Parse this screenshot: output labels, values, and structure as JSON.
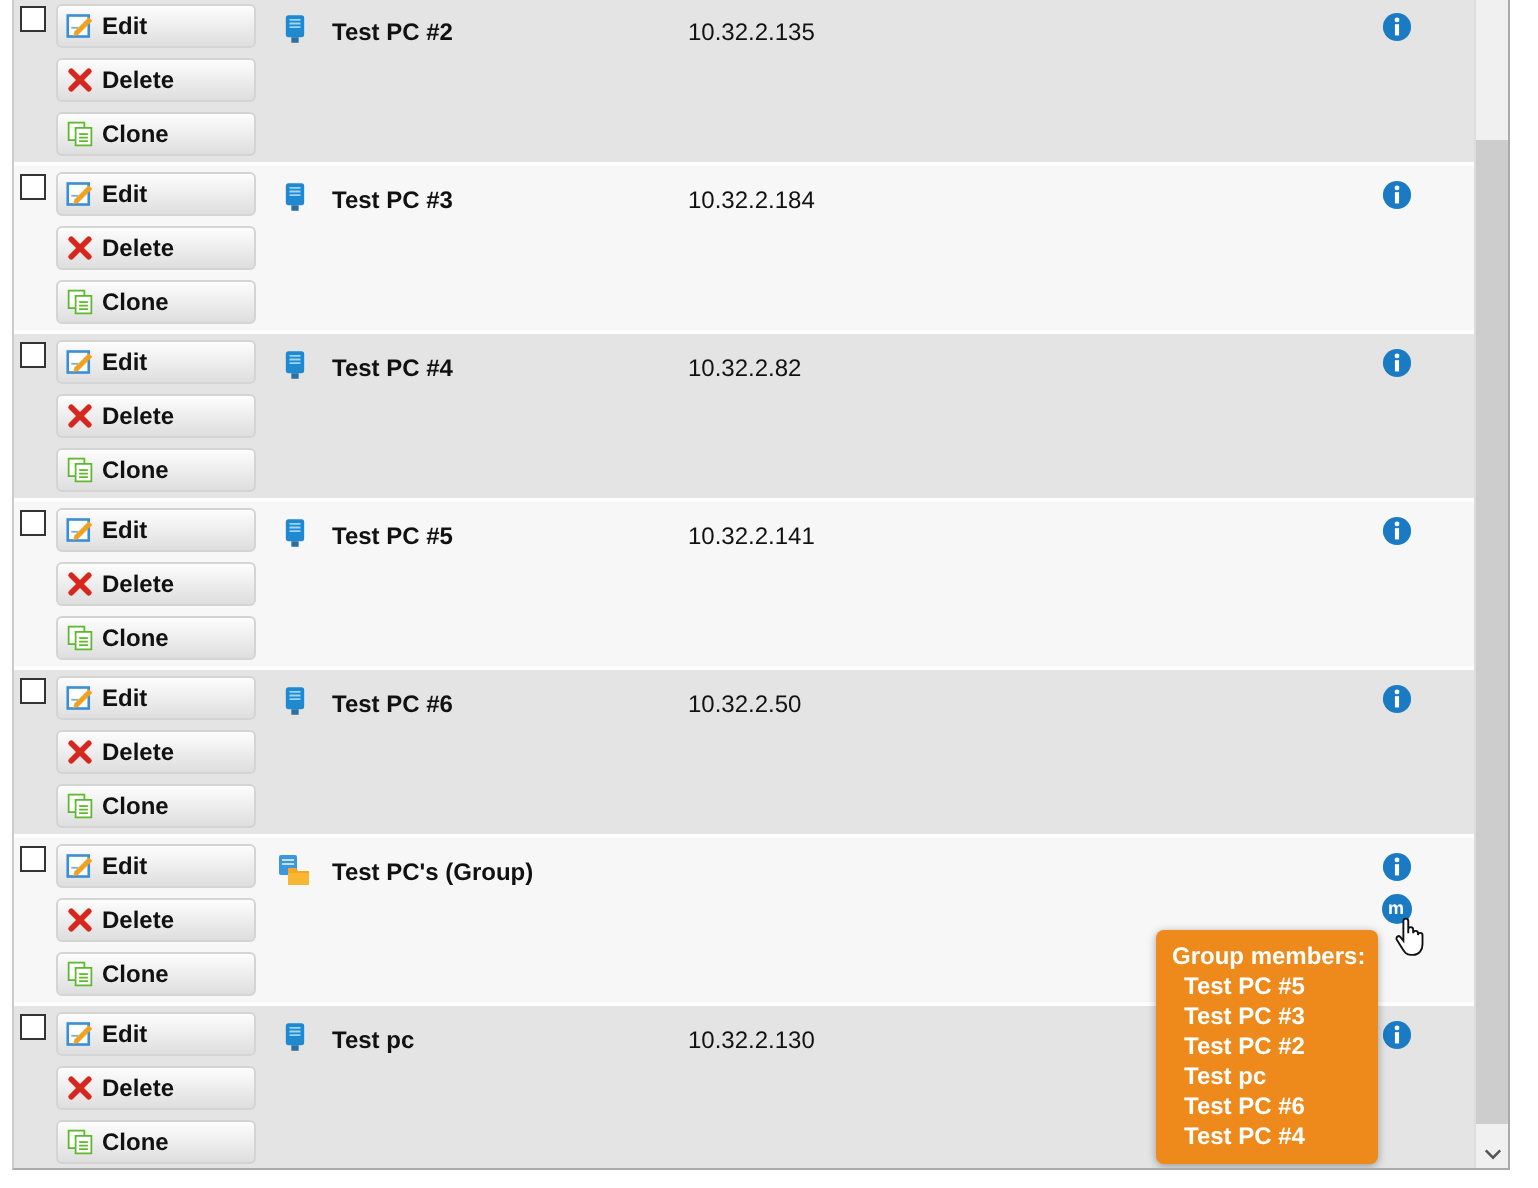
{
  "rows": [
    {
      "kind": "pc",
      "checked": false,
      "name": "Test PC #2",
      "ip": "10.32.2.135",
      "actions": [
        {
          "kind": "edit",
          "label": "Edit"
        },
        {
          "kind": "delete",
          "label": "Delete"
        },
        {
          "kind": "clone",
          "label": "Clone"
        }
      ]
    },
    {
      "kind": "pc",
      "checked": false,
      "name": "Test PC #3",
      "ip": "10.32.2.184",
      "actions": [
        {
          "kind": "edit",
          "label": "Edit"
        },
        {
          "kind": "delete",
          "label": "Delete"
        },
        {
          "kind": "clone",
          "label": "Clone"
        }
      ]
    },
    {
      "kind": "pc",
      "checked": false,
      "name": "Test PC #4",
      "ip": "10.32.2.82",
      "actions": [
        {
          "kind": "edit",
          "label": "Edit"
        },
        {
          "kind": "delete",
          "label": "Delete"
        },
        {
          "kind": "clone",
          "label": "Clone"
        }
      ]
    },
    {
      "kind": "pc",
      "checked": false,
      "name": "Test PC #5",
      "ip": "10.32.2.141",
      "actions": [
        {
          "kind": "edit",
          "label": "Edit"
        },
        {
          "kind": "delete",
          "label": "Delete"
        },
        {
          "kind": "clone",
          "label": "Clone"
        }
      ]
    },
    {
      "kind": "pc",
      "checked": false,
      "name": "Test PC #6",
      "ip": "10.32.2.50",
      "actions": [
        {
          "kind": "edit",
          "label": "Edit"
        },
        {
          "kind": "delete",
          "label": "Delete"
        },
        {
          "kind": "clone",
          "label": "Clone"
        }
      ]
    },
    {
      "kind": "group",
      "checked": false,
      "name": "Test PC's (Group)",
      "members_button": "m",
      "tooltip": {
        "title": "Group members:",
        "members": [
          "Test PC #5",
          "Test PC #3",
          "Test PC #2",
          "Test pc",
          "Test PC #6",
          "Test PC #4"
        ]
      },
      "actions": [
        {
          "kind": "edit",
          "label": "Edit"
        },
        {
          "kind": "delete",
          "label": "Delete"
        },
        {
          "kind": "clone",
          "label": "Clone"
        }
      ]
    },
    {
      "kind": "pc",
      "checked": false,
      "name": "Test pc",
      "ip": "10.32.2.130",
      "actions": [
        {
          "kind": "edit",
          "label": "Edit"
        },
        {
          "kind": "delete",
          "label": "Delete"
        },
        {
          "kind": "clone",
          "label": "Clone"
        }
      ]
    }
  ]
}
